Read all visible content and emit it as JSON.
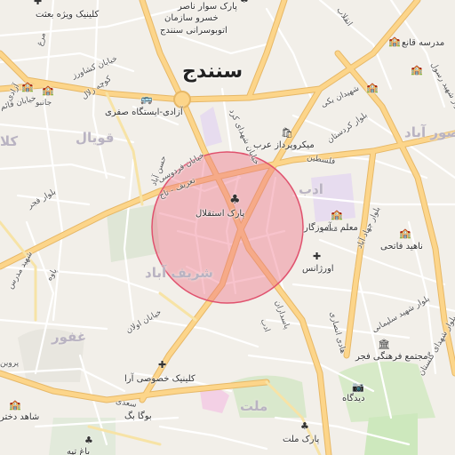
{
  "map": {
    "city_label": "سنندج",
    "districts": [
      {
        "id": "ghovil",
        "text": "قویال"
      },
      {
        "id": "adab",
        "text": "ادب"
      },
      {
        "id": "sharifabad",
        "text": "شریف آباد"
      },
      {
        "id": "ghafoor",
        "text": "غفور"
      },
      {
        "id": "mellat",
        "text": "ملت"
      },
      {
        "id": "mansourabad",
        "text": "منصور آباد"
      },
      {
        "id": "kala",
        "text": "کلا"
      }
    ],
    "streets": [
      {
        "id": "keshavarz",
        "text": "خیابان کشاورز"
      },
      {
        "id": "ferdowsi",
        "text": "خیابان فردوسی"
      },
      {
        "id": "hasanabad",
        "text": "حسن آباد"
      },
      {
        "id": "taarif_taj",
        "text": "تعریف - تاج"
      },
      {
        "id": "shohada_kord",
        "text": "خیابان شهدای کرد"
      },
      {
        "id": "bolvar_fajr",
        "text": "بلوار فجر"
      },
      {
        "id": "bolvar_kordestan",
        "text": "بلوار کردستان"
      },
      {
        "id": "shahidan_baki",
        "text": "شهیدان بکی"
      },
      {
        "id": "felestin",
        "text": "فلسطین"
      },
      {
        "id": "jahad_abad",
        "text": "بلوار جهاد آباد"
      },
      {
        "id": "oulan",
        "text": "خیابان اولان"
      },
      {
        "id": "pasdaran",
        "text": "پاسداران"
      },
      {
        "id": "adab_st",
        "text": "ادب"
      },
      {
        "id": "saadi",
        "text": "سعدی"
      },
      {
        "id": "shahid_soleimani",
        "text": "بلوار شهید سلیمانی"
      },
      {
        "id": "hadi_ansari",
        "text": "هادی انصاری"
      },
      {
        "id": "golestan",
        "text": "بلوار شهدای گلستان"
      },
      {
        "id": "shahid_rasoul",
        "text": "بلوار شهید رسول"
      },
      {
        "id": "koucheh_zalal",
        "text": "کوچه زلال"
      },
      {
        "id": "ghaem",
        "text": "خیابان قائم"
      },
      {
        "id": "enghelab",
        "text": "انقلاب"
      },
      {
        "id": "shahid_modares",
        "text": "شهید مدرس"
      },
      {
        "id": "moalem",
        "text": "معلم"
      },
      {
        "id": "margh",
        "text": "مرغ"
      },
      {
        "id": "paveh",
        "text": "پاوه"
      },
      {
        "id": "azadi",
        "text": "آزادی"
      },
      {
        "id": "parvin",
        "text": "پروین"
      },
      {
        "id": "janboo",
        "text": "جانبو"
      }
    ],
    "pois": [
      {
        "id": "clinic_vijeh",
        "text": "کلینیک ویژه بعثت",
        "icon": "hospital-cross-icon"
      },
      {
        "id": "park_savar",
        "text": "پارک سوار ناصر",
        "icon": "tree-icon"
      },
      {
        "id": "khosrow",
        "text": "خسرو سازمان",
        "icon": "none"
      },
      {
        "id": "otobusrani",
        "text": "اتوبوسرانی سنندج",
        "icon": "none"
      },
      {
        "id": "madreseh",
        "text": "مدرسه قانع",
        "icon": "school-icon"
      },
      {
        "id": "istgah",
        "text": "آزادی-ایستگاه صفری",
        "icon": "bus-icon"
      },
      {
        "id": "mikropardaz",
        "text": "میکروپرداز عرب",
        "icon": "shop-icon"
      },
      {
        "id": "park_esteghlal",
        "text": "پارک استقلال",
        "icon": "tree-icon"
      },
      {
        "id": "moalem_amouzgar",
        "text": "معلم - آموزگار",
        "icon": "school-icon"
      },
      {
        "id": "naheed",
        "text": "ناهید فاتحی",
        "icon": "school-icon"
      },
      {
        "id": "emergency",
        "text": "اورژانس",
        "icon": "hospital-cross-icon"
      },
      {
        "id": "majmaeh",
        "text": "مجتمع فرهنگی فجر",
        "icon": "culture-icon"
      },
      {
        "id": "clinic_ara",
        "text": "کلینیک خصوصی آرا",
        "icon": "hospital-cross-icon"
      },
      {
        "id": "didgah",
        "text": "دیدگاه",
        "icon": "camera-icon"
      },
      {
        "id": "boogabag",
        "text": "بوگا بگ",
        "icon": "shop-icon"
      },
      {
        "id": "park_mellat",
        "text": "پارک ملت",
        "icon": "tree-icon"
      },
      {
        "id": "shahed",
        "text": "شاهد دختر",
        "icon": "school-icon"
      },
      {
        "id": "bagh",
        "text": "باغ تپه",
        "icon": "tree-icon"
      }
    ],
    "colors": {
      "background": "#f2efe9",
      "major_road": "#fcd58a",
      "major_road_casing": "#e7b867",
      "minor_road": "#ffffff",
      "park": "#cde8bd",
      "highlight_fill": "#ef6f86",
      "highlight_stroke": "#e0526e",
      "special_area": "#e7dcef"
    }
  }
}
